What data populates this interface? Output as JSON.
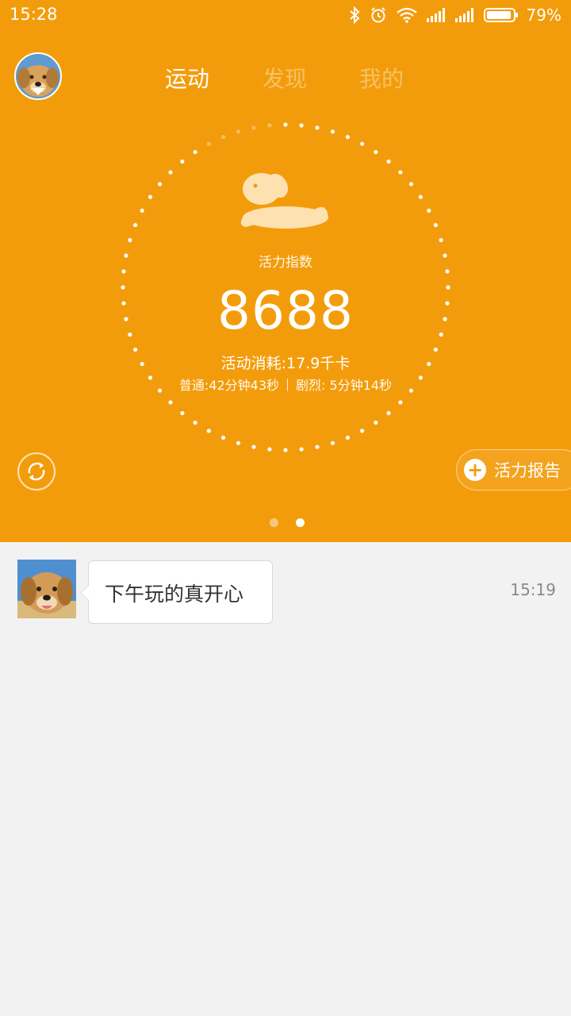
{
  "status_bar": {
    "time": "15:28",
    "battery_percent": "79%",
    "icons": [
      "bluetooth-icon",
      "alarm-icon",
      "wifi-icon",
      "signal-icon",
      "signal-icon",
      "battery-icon"
    ]
  },
  "header": {
    "avatar_icon": "dog-avatar",
    "tabs": [
      {
        "label": "运动",
        "active": true
      },
      {
        "label": "发现",
        "active": false
      },
      {
        "label": "我的",
        "active": false
      }
    ]
  },
  "activity": {
    "icon": "dog-icon",
    "label": "活力指数",
    "value": "8688",
    "burn": "活动消耗:17.9千卡",
    "normal": "普通:42分钟43秒",
    "intense": "剧烈: 5分钟14秒",
    "ring_progress": 0.92
  },
  "actions": {
    "refresh_icon": "refresh-icon",
    "report_label": "活力报告",
    "report_icon": "plus-icon"
  },
  "pager": {
    "count": 2,
    "active": 2
  },
  "messages": [
    {
      "text": "下午玩的真开心",
      "time": "15:19"
    }
  ],
  "colors": {
    "accent": "#f39c0b",
    "background": "#f2f2f2"
  }
}
